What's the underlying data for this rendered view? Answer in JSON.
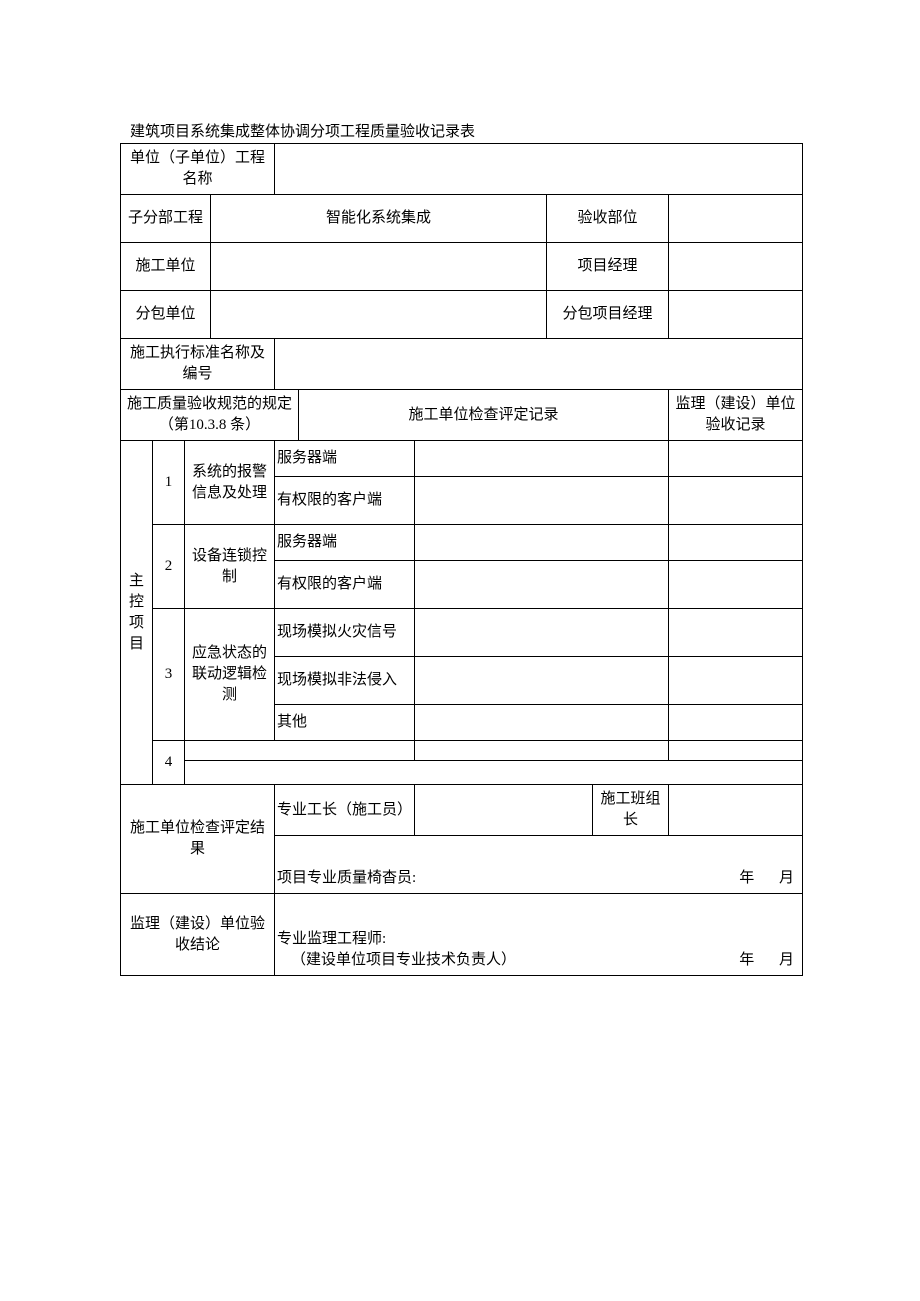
{
  "title": "建筑项目系统集成整体协调分项工程质量验收记录表",
  "labels": {
    "unit_name": "单位（子单位）工程名称",
    "sub_division": "子分部工程",
    "sub_division_value": "智能化系统集成",
    "accept_part": "验收部位",
    "constructor": "施工单位",
    "project_mgr": "项目经理",
    "subcontractor": "分包单位",
    "sub_project_mgr": "分包项目经理",
    "exec_std": "施工执行标准名称及编号",
    "quality_spec": "施工质量验收规范的规定（第10.3.8 条）",
    "constructor_check_record": "施工单位检查评定记录",
    "supervisor_accept_record": "监理（建设）单位验收记录",
    "main_control": "主控项目",
    "row1_label": "系统的报警信息及处理",
    "row1_a": "服务器端",
    "row1_b": "有权限的客户端",
    "row2_label": "设备连锁控制",
    "row2_a": "服务器端",
    "row2_b": "有权限的客户端",
    "row3_label": "应急状态的联动逻辑检测",
    "row3_a": "现场模拟火灾信号",
    "row3_b": "现场模拟非法侵入",
    "row3_c": "其他",
    "num1": "1",
    "num2": "2",
    "num3": "3",
    "num4": "4",
    "constructor_check_result": "施工单位检查评定结果",
    "pro_foreman": "专业工长（施工员）",
    "team_leader": "施工班组长",
    "quality_inspector": "项目专业质量椅杳员:",
    "supervisor_conclusion": "监理（建设）单位验收结论",
    "pro_supervisor": "专业监理工程师:",
    "owner_tech_lead": "（建设单位项目专业技术负责人）",
    "year": "年",
    "month": "月"
  }
}
